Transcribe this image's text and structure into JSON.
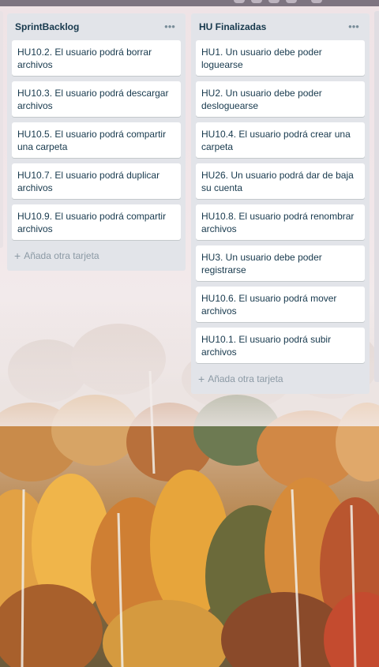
{
  "lists": [
    {
      "title": "SprintBacklog",
      "cards": [
        "HU10.2. El usuario podrá borrar archivos",
        "HU10.3. El usuario podrá descargar archivos",
        "HU10.5. El usuario podrá compartir una carpeta",
        "HU10.7. El usuario podrá duplicar archivos",
        "HU10.9. El usuario podrá compartir archivos"
      ],
      "add_card_label": "Añada otra tarjeta"
    },
    {
      "title": "HU Finalizadas",
      "cards": [
        "HU1. Un usuario debe poder loguearse",
        "HU2. Un usuario debe poder desloguearse",
        "HU10.4. El usuario podrá crear una carpeta",
        "HU26. Un usuario podrá dar de baja su cuenta",
        "HU10.8. El usuario podrá renombrar archivos",
        "HU3. Un usuario debe poder registrarse",
        "HU10.6. El usuario podrá mover archivos",
        "HU10.1. El usuario podrá subir archivos"
      ],
      "add_card_label": "Añada otra tarjeta"
    }
  ],
  "icons": {
    "list_menu": "more-horizontal-icon",
    "add_card": "plus-icon"
  },
  "colors": {
    "list_bg": "#e2e4e9",
    "card_bg": "#ffffff",
    "text": "#17394d",
    "muted": "#8c9aa5"
  }
}
